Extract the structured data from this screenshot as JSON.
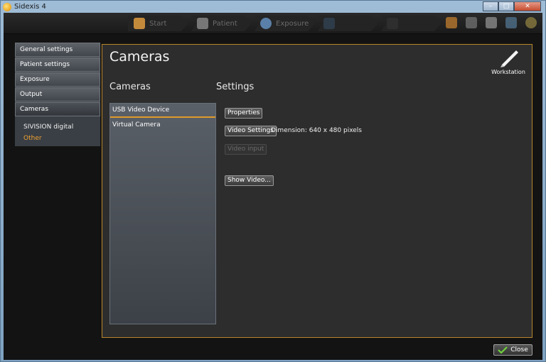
{
  "window": {
    "title": "Sidexis 4"
  },
  "window_buttons": [
    "–",
    "□",
    "✕"
  ],
  "steps": [
    {
      "label": "Start",
      "icon": "start-icon",
      "color": "#c48a3c"
    },
    {
      "label": "Patient",
      "icon": "patient-icon",
      "color": "#777777"
    },
    {
      "label": "Exposure",
      "icon": "exposure-icon",
      "color": "#5a7fa8"
    },
    {
      "label": "",
      "icon": "examine-icon",
      "color": "#2e3b48"
    },
    {
      "label": "",
      "icon": "output-icon",
      "color": "#2e2e2e"
    }
  ],
  "menu": {
    "items": [
      "General settings",
      "Patient settings",
      "Exposure",
      "Output",
      "Cameras"
    ],
    "subitems": [
      "SIVISION digital",
      "Other"
    ]
  },
  "panel": {
    "title": "Cameras",
    "workstation_label": "Workstation",
    "cameras_heading": "Cameras",
    "settings_heading": "Settings",
    "camera_list": [
      "USB Video Device",
      "Virtual Camera"
    ],
    "buttons": {
      "properties": "Properties",
      "video_settings": "Video Settings",
      "video_input": "Video input",
      "show_video": "Show Video..."
    },
    "dimension_text": "Dimension: 640 x 480 pixels"
  },
  "footer": {
    "close_label": "Close"
  },
  "colors": {
    "accent": "#e19a2a",
    "panel_border": "#b8862b"
  }
}
